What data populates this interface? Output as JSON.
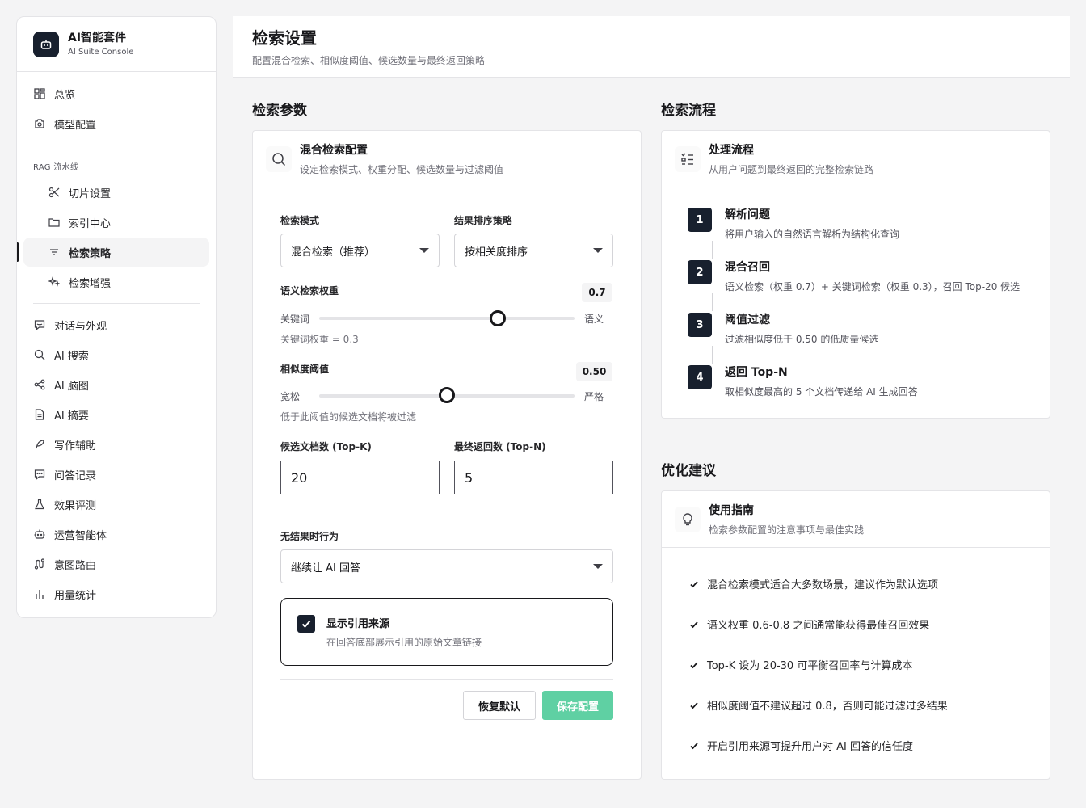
{
  "brand": {
    "title": "AI智能套件",
    "subtitle": "AI Suite Console"
  },
  "nav": {
    "overview": "总览",
    "model_config": "模型配置",
    "rag_group": "RAG 流水线",
    "chunk": "切片设置",
    "index": "索引中心",
    "retrieval": "检索策略",
    "enhance": "检索增强",
    "dialog": "对话与外观",
    "ai_search": "AI 搜索",
    "ai_mindmap": "AI 脑图",
    "ai_summary": "AI 摘要",
    "writing": "写作辅助",
    "qa_log": "问答记录",
    "eval": "效果评测",
    "ops_agent": "运营智能体",
    "intent": "意图路由",
    "usage": "用量统计"
  },
  "header": {
    "title": "检索设置",
    "subtitle": "配置混合检索、相似度阈值、候选数量与最终返回策略"
  },
  "params": {
    "section_title": "检索参数",
    "card_title": "混合检索配置",
    "card_subtitle": "设定检索模式、权重分配、候选数量与过滤阈值",
    "mode_label": "检索模式",
    "mode_value": "混合检索（推荐）",
    "sort_label": "结果排序策略",
    "sort_value": "按相关度排序",
    "semantic_label": "语义检索权重",
    "semantic_value": "0.7",
    "semantic_level": 0.7,
    "kw_left": "关键词",
    "kw_right": "语义",
    "kw_weight_hint": "关键词权重 = 0.3",
    "sim_label": "相似度阈值",
    "sim_value": "0.50",
    "sim_level": 0.5,
    "sim_left": "宽松",
    "sim_right": "严格",
    "sim_hint": "低于此阈值的候选文档将被过滤",
    "topk_label": "候选文档数 (Top-K)",
    "topk_value": "20",
    "topn_label": "最终返回数 (Top-N)",
    "topn_value": "5",
    "noresult_label": "无结果时行为",
    "noresult_value": "继续让 AI 回答",
    "cite_title": "显示引用来源",
    "cite_desc": "在回答底部展示引用的原始文章链接",
    "cite_checked": true,
    "reset_button": "恢复默认",
    "save_button": "保存配置",
    "save_color": "#5fd0a3"
  },
  "flow": {
    "section_title": "检索流程",
    "card_title": "处理流程",
    "card_subtitle": "从用户问题到最终返回的完整检索链路",
    "steps": [
      {
        "num": "1",
        "title": "解析问题",
        "desc": "将用户输入的自然语言解析为结构化查询"
      },
      {
        "num": "2",
        "title": "混合召回",
        "desc": "语义检索（权重 0.7）+ 关键词检索（权重 0.3），召回 Top-20 候选"
      },
      {
        "num": "3",
        "title": "阈值过滤",
        "desc": "过滤相似度低于 0.50 的低质量候选"
      },
      {
        "num": "4",
        "title": "返回 Top-N",
        "desc": "取相似度最高的 5 个文档传递给 AI 生成回答"
      }
    ]
  },
  "tips": {
    "section_title": "优化建议",
    "card_title": "使用指南",
    "card_subtitle": "检索参数配置的注意事项与最佳实践",
    "items": [
      "混合检索模式适合大多数场景，建议作为默认选项",
      "语义权重 0.6-0.8 之间通常能获得最佳召回效果",
      "Top-K 设为 20-30 可平衡召回率与计算成本",
      "相似度阈值不建议超过 0.8，否则可能过滤过多结果",
      "开启引用来源可提升用户对 AI 回答的信任度"
    ]
  }
}
